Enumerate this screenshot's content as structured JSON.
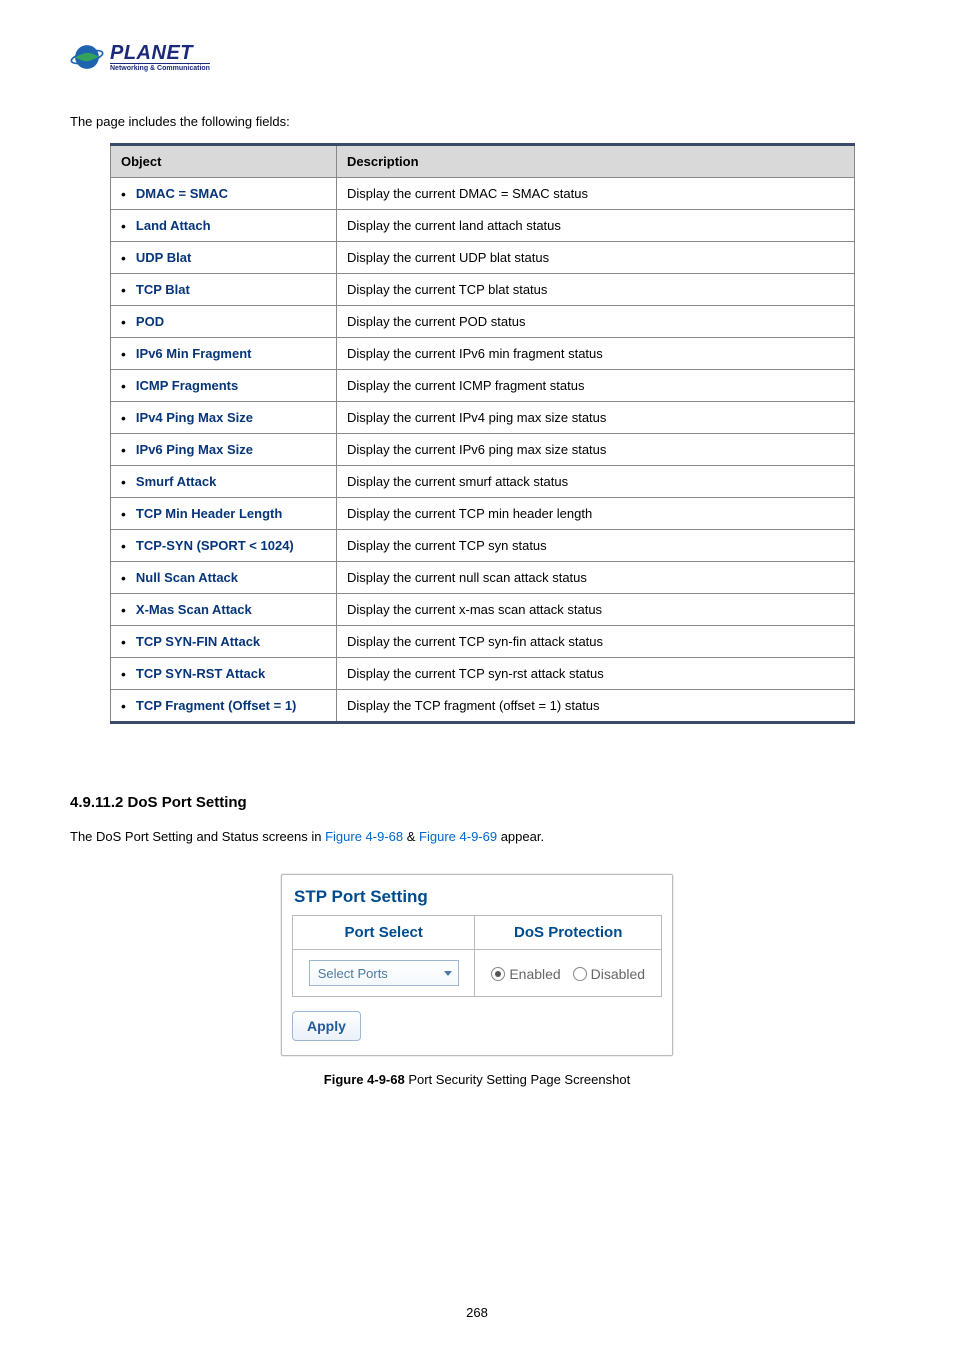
{
  "logo": {
    "brand": "PLANET",
    "tagline": "Networking & Communication"
  },
  "intro": "The page includes the following fields:",
  "tableHeaders": {
    "object": "Object",
    "description": "Description"
  },
  "rows": [
    {
      "obj": "DMAC = SMAC",
      "desc": "Display the current DMAC = SMAC status"
    },
    {
      "obj": "Land Attach",
      "desc": "Display the current land attach status"
    },
    {
      "obj": "UDP Blat",
      "desc": "Display the current UDP blat status"
    },
    {
      "obj": "TCP Blat",
      "desc": "Display the current TCP blat status"
    },
    {
      "obj": "POD",
      "desc": "Display the current POD status"
    },
    {
      "obj": "IPv6 Min Fragment",
      "desc": "Display the current IPv6 min fragment status"
    },
    {
      "obj": "ICMP Fragments",
      "desc": "Display the current ICMP fragment status"
    },
    {
      "obj": "IPv4 Ping Max Size",
      "desc": "Display the current IPv4 ping max size status"
    },
    {
      "obj": "IPv6 Ping Max Size",
      "desc": "Display the current IPv6 ping max size status"
    },
    {
      "obj": "Smurf Attack",
      "desc": "Display the current smurf attack status"
    },
    {
      "obj": "TCP Min Header Length",
      "desc": "Display the current TCP min header length"
    },
    {
      "obj": "TCP-SYN (SPORT < 1024)",
      "desc": "Display the current TCP syn status"
    },
    {
      "obj": "Null Scan Attack",
      "desc": "Display the current null scan attack status"
    },
    {
      "obj": "X-Mas Scan Attack",
      "desc": "Display the current x-mas scan attack status"
    },
    {
      "obj": "TCP SYN-FIN Attack",
      "desc": "Display the current TCP syn-fin attack status"
    },
    {
      "obj": "TCP SYN-RST Attack",
      "desc": "Display the current TCP syn-rst attack status"
    },
    {
      "obj": "TCP Fragment (Offset = 1)",
      "desc": "Display the TCP fragment (offset = 1) status"
    }
  ],
  "section": {
    "heading": "4.9.11.2 DoS Port Setting",
    "sentence_pre": "The DoS Port Setting and Status screens in ",
    "figref1": "Figure 4-9-68",
    "amp": " & ",
    "figref2": "Figure 4-9-69",
    "sentence_post": " appear."
  },
  "screenshot": {
    "title": "STP Port Setting",
    "col1": "Port Select",
    "col2": "DoS Protection",
    "dropdown": "Select Ports",
    "opt_enabled": "Enabled",
    "opt_disabled": "Disabled",
    "apply": "Apply"
  },
  "caption": {
    "strong": "Figure 4-9-68",
    "rest": " Port Security Setting Page Screenshot"
  },
  "pageNumber": "268"
}
